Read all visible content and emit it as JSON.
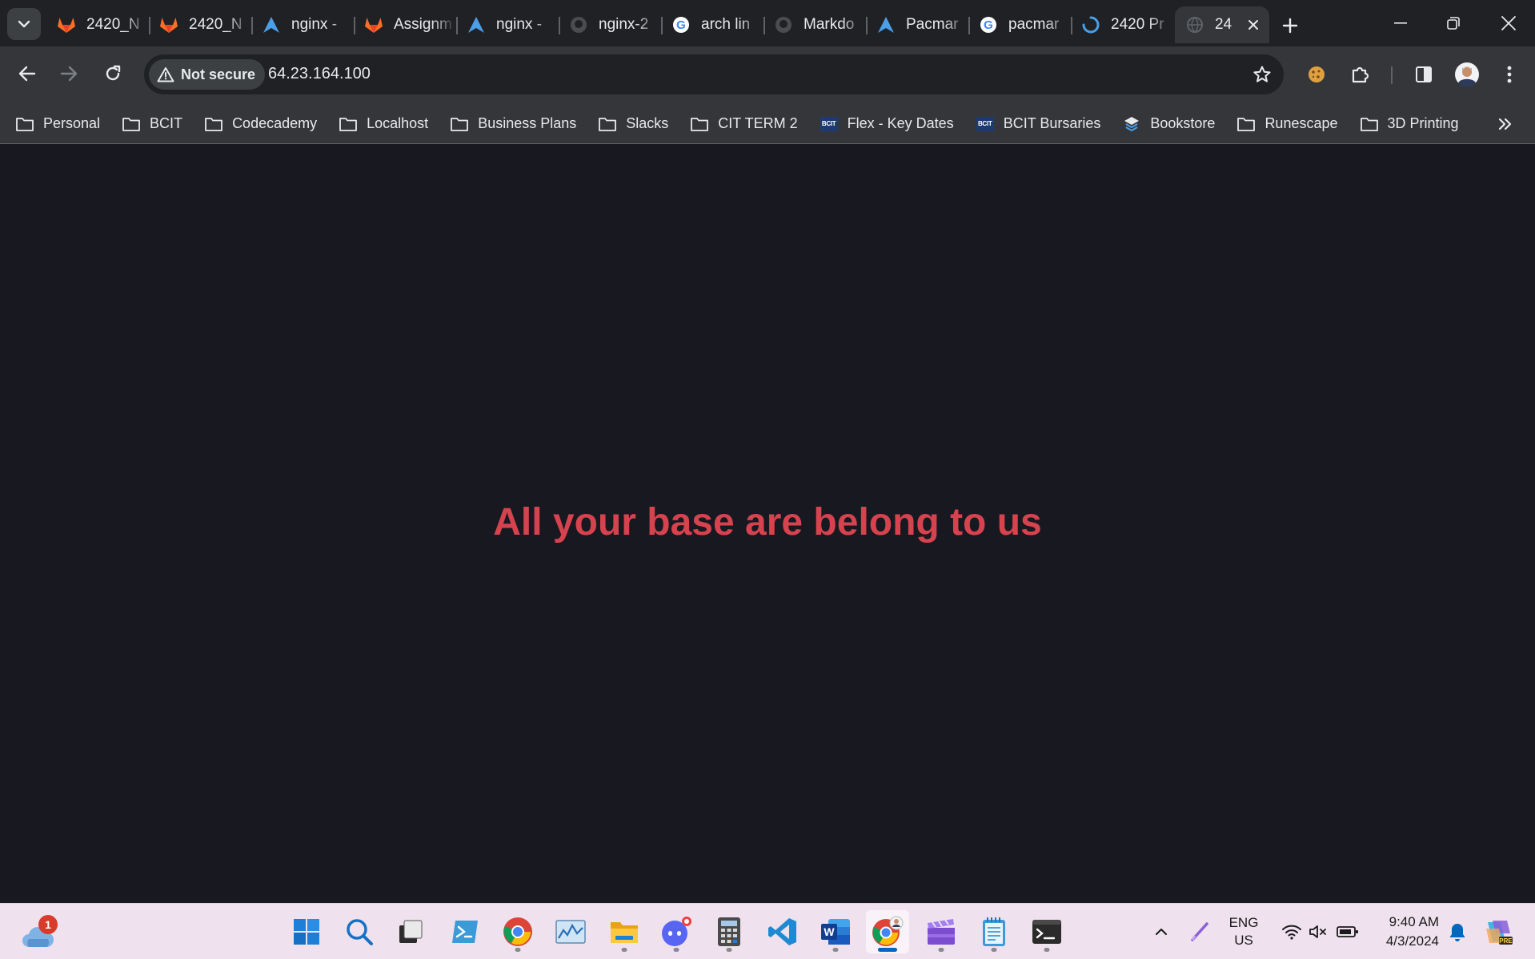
{
  "tabs": [
    {
      "title": "2420_N",
      "favicon": "gitlab-icon"
    },
    {
      "title": "2420_N",
      "favicon": "gitlab-icon"
    },
    {
      "title": "nginx -",
      "favicon": "arch-linux-icon"
    },
    {
      "title": "Assignm",
      "favicon": "gitlab-icon"
    },
    {
      "title": "nginx -",
      "favicon": "arch-linux-icon"
    },
    {
      "title": "nginx-2",
      "favicon": "github-icon"
    },
    {
      "title": "arch lin",
      "favicon": "google-icon"
    },
    {
      "title": "Markdo",
      "favicon": "github-icon"
    },
    {
      "title": "Pacmar",
      "favicon": "arch-linux-icon"
    },
    {
      "title": "pacmar",
      "favicon": "google-icon"
    },
    {
      "title": "2420 Pr",
      "favicon": "loading-icon"
    },
    {
      "title": "24",
      "favicon": "globe-icon",
      "active": true
    }
  ],
  "toolbar": {
    "security_label": "Not secure",
    "url": "64.23.164.100"
  },
  "bookmarks": [
    {
      "label": "Personal",
      "icon": "folder-icon"
    },
    {
      "label": "BCIT",
      "icon": "folder-icon"
    },
    {
      "label": "Codecademy",
      "icon": "folder-icon"
    },
    {
      "label": "Localhost",
      "icon": "folder-icon"
    },
    {
      "label": "Business Plans",
      "icon": "folder-icon"
    },
    {
      "label": "Slacks",
      "icon": "folder-icon"
    },
    {
      "label": "CIT TERM 2",
      "icon": "folder-icon"
    },
    {
      "label": "Flex - Key Dates",
      "icon": "bcit-logo-icon"
    },
    {
      "label": "BCIT Bursaries",
      "icon": "bcit-logo-icon"
    },
    {
      "label": "Bookstore",
      "icon": "bookstore-icon"
    },
    {
      "label": "Runescape",
      "icon": "folder-icon"
    },
    {
      "label": "3D Printing",
      "icon": "folder-icon"
    }
  ],
  "bcit_logo_text": "BCIT",
  "page": {
    "headline": "All your base are belong to us",
    "background_color": "#181821",
    "headline_color": "#d6434f"
  },
  "taskbar": {
    "weather_badge": "1",
    "apps": [
      "start-icon",
      "search-icon",
      "task-view-icon",
      "powershell-icon",
      "chrome-icon",
      "resource-monitor-icon",
      "file-explorer-icon",
      "discord-icon",
      "calculator-icon",
      "vscode-icon",
      "word-icon",
      "chrome-profile-icon",
      "clipchamp-icon",
      "notepad-icon",
      "terminal-icon"
    ],
    "lang_primary": "ENG",
    "lang_secondary": "US",
    "time": "9:40 AM",
    "date": "4/3/2024"
  }
}
